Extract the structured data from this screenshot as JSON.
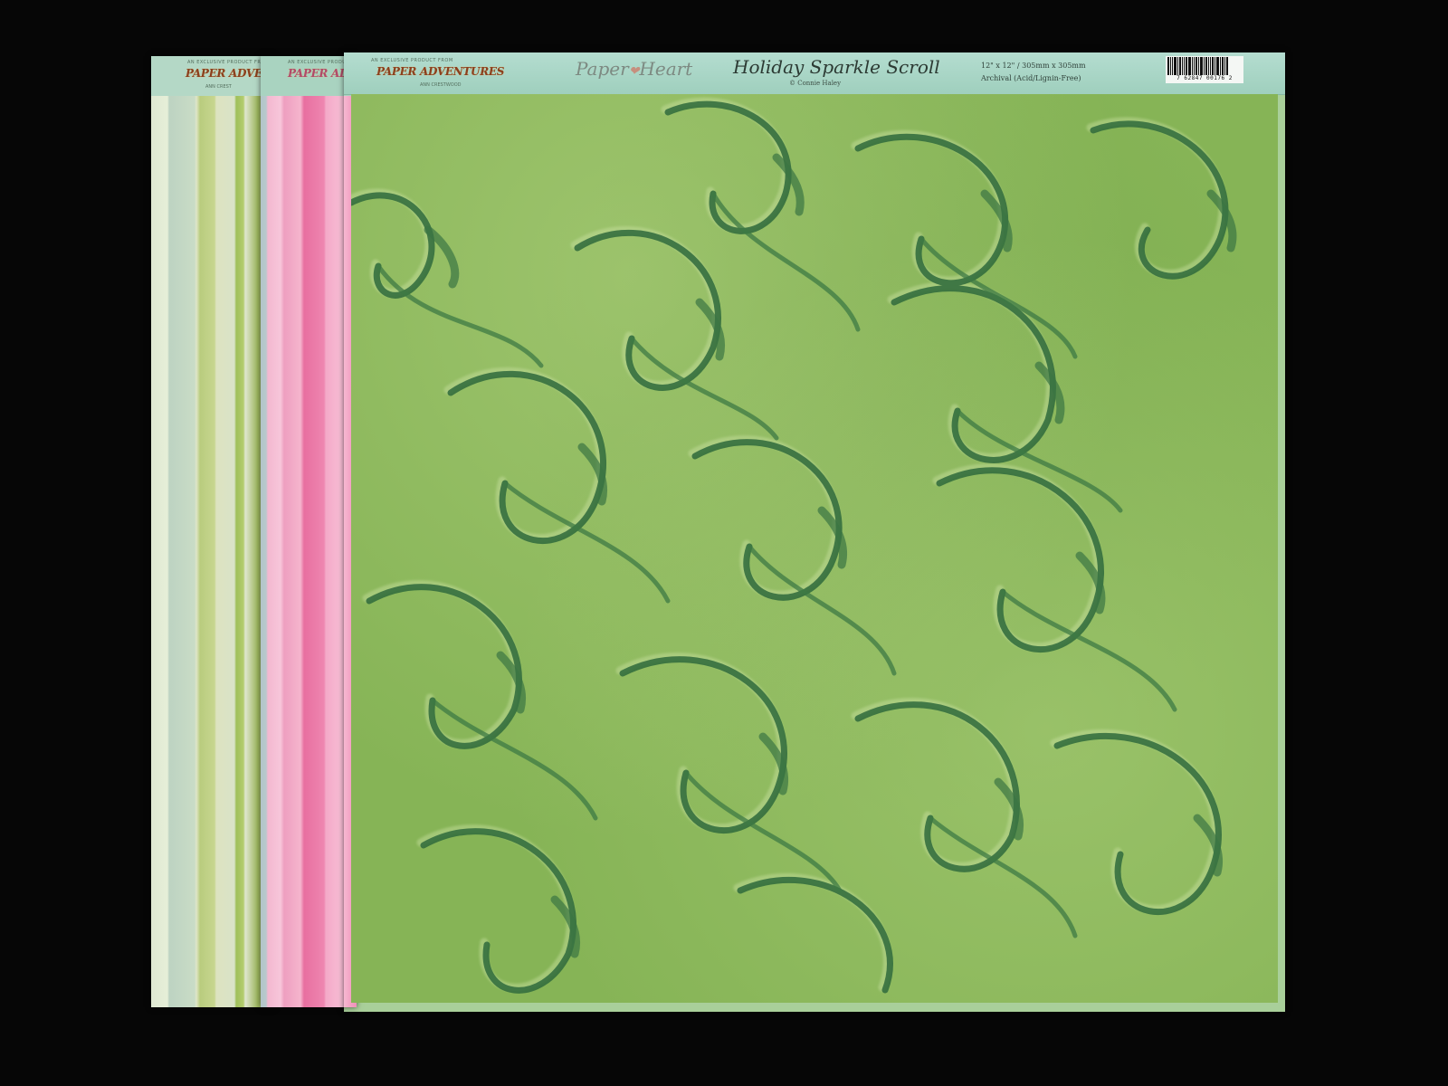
{
  "back_sheet": {
    "tagline": "AN EXCLUSIVE PRODUCT FROM",
    "brand": "PAPER ADVENTURES",
    "sub": "ANN CREST"
  },
  "middle_sheet": {
    "tagline": "AN EXCLUSIVE PRODUCT FROM",
    "brand": "PAPER ADVENTURES"
  },
  "front_sheet": {
    "tagline": "AN EXCLUSIVE PRODUCT FROM",
    "brand": "PAPER ADVENTURES",
    "sub": "ANN CRESTWOOD",
    "logo_left": "Paper",
    "logo_right": "Heart",
    "title": "Holiday Sparkle Scroll",
    "copyright": "© Connie Haley",
    "size": "12\" x 12\" / 305mm x 305mm",
    "archival": "Archival (Acid/Lignin-Free)",
    "barcode_number": "7 62847 00176 2"
  },
  "colors": {
    "background": "#060606",
    "front_paper_green": "#86b456",
    "scroll_dark": "#2f6a3c",
    "header_mint": "#a9d3c0",
    "pink_stripe": "#ee86b0"
  }
}
